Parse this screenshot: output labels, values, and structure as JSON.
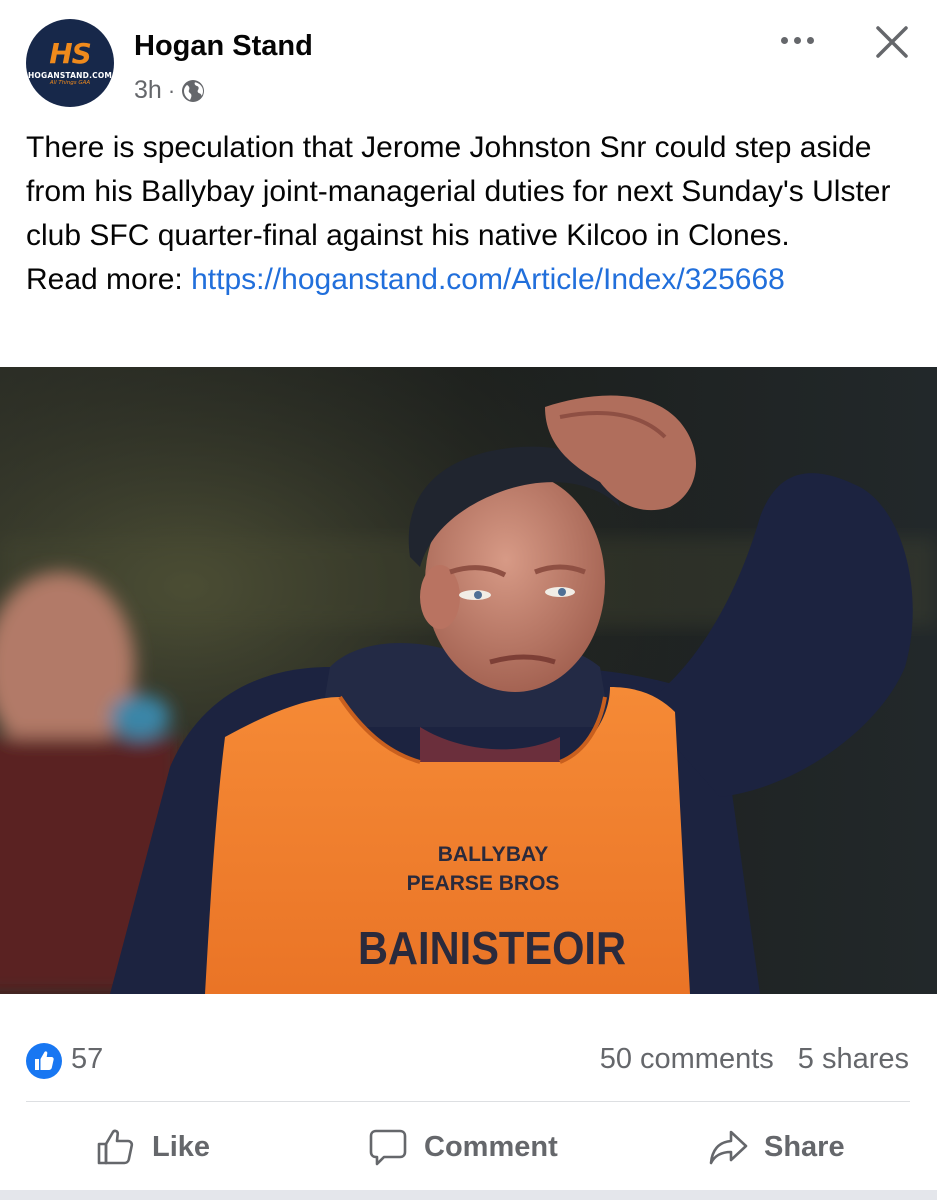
{
  "header": {
    "page_name": "Hogan Stand",
    "time": "3h",
    "separator": "·",
    "avatar": {
      "logo_text": "HS",
      "site_text": "HOGANSTAND.COM",
      "tagline": "All Things GAA"
    },
    "icons": {
      "audience": "globe-icon",
      "more": "more-icon",
      "close": "close-icon"
    }
  },
  "post": {
    "text": "There is speculation that Jerome Johnston Snr could step aside from his Ballybay joint-managerial duties for next Sunday's Ulster club SFC quarter-final against his native Kilcoo in Clones.",
    "read_more_label": "Read more:",
    "link": "https://hoganstand.com/Article/Index/325668"
  },
  "photo": {
    "bib_line1": "BALLYBAY",
    "bib_line2": "PEARSE BROS",
    "bib_line3": "BAINISTEOIR"
  },
  "stats": {
    "likes": "57",
    "comments": "50 comments",
    "shares": "5 shares"
  },
  "actions": {
    "like": "Like",
    "comment": "Comment",
    "share": "Share"
  },
  "colors": {
    "link": "#216fdb",
    "like_badge": "#1877f2",
    "secondary_text": "#65676b",
    "vest": "#f2822e"
  }
}
